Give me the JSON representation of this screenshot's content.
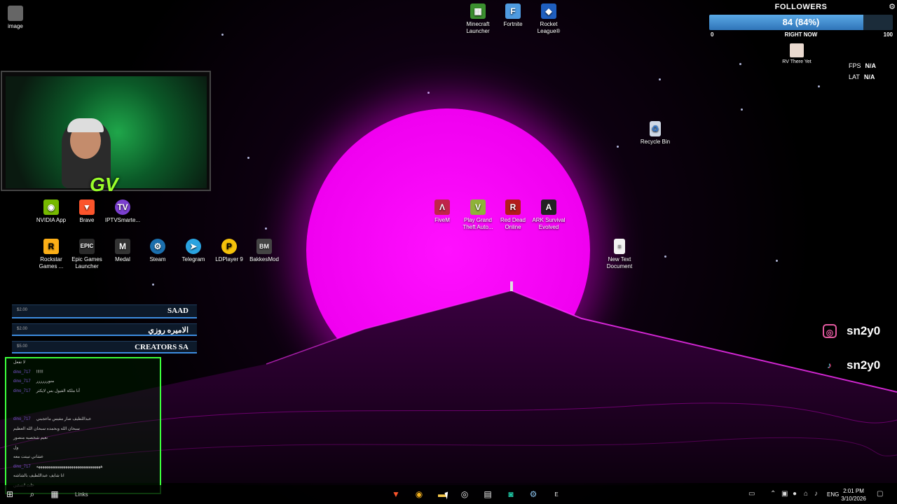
{
  "desktop_icons": {
    "top_left": {
      "label": "image",
      "icon": "image-file-icon"
    },
    "games_top": [
      {
        "label": "Minecraft Launcher",
        "icon": "minecraft-icon",
        "color": "#3b8f2f"
      },
      {
        "label": "Fortnite",
        "icon": "fortnite-icon",
        "color": "#4f9be0"
      },
      {
        "label": "Rocket League®",
        "icon": "rocket-league-icon",
        "color": "#1f5fbf"
      }
    ],
    "row1": [
      {
        "label": "NVIDIA App",
        "icon": "nvidia-icon",
        "color": "#76b900"
      },
      {
        "label": "Brave",
        "icon": "brave-icon",
        "color": "#fb542b"
      },
      {
        "label": "IPTVSmarte...",
        "icon": "iptv-icon",
        "color": "#7b3fd0"
      }
    ],
    "row2": [
      {
        "label": "Rockstar Games ...",
        "icon": "rockstar-icon",
        "color": "#fcaf17"
      },
      {
        "label": "Epic Games Launcher",
        "icon": "epic-games-icon",
        "color": "#2a2a2a"
      },
      {
        "label": "Medal",
        "icon": "medal-icon",
        "color": "#333333"
      },
      {
        "label": "Steam",
        "icon": "steam-icon",
        "color": "#1b6fae"
      },
      {
        "label": "Telegram",
        "icon": "telegram-icon",
        "color": "#2aa3e0"
      },
      {
        "label": "LDPlayer 9",
        "icon": "ldplayer-icon",
        "color": "#f5c20b"
      },
      {
        "label": "BakkesMod",
        "icon": "bakkesmod-icon",
        "color": "#444444"
      }
    ],
    "center": [
      {
        "label": "FiveM",
        "icon": "fivem-icon",
        "color": "#c0244a"
      },
      {
        "label": "Play Grand Theft Auto...",
        "icon": "gta-icon",
        "color": "#8fb339"
      },
      {
        "label": "Red Dead Online",
        "icon": "red-dead-icon",
        "color": "#b31b1b"
      },
      {
        "label": "ARK Survival Evolved",
        "icon": "ark-icon",
        "color": "#222222"
      }
    ],
    "recycle_bin": {
      "label": "Recycle Bin",
      "icon": "recycle-bin-icon"
    },
    "new_text": {
      "label": "New Text Document",
      "icon": "text-document-icon"
    }
  },
  "followers": {
    "title": "FOLLOWERS",
    "value": "84 (84%)",
    "progress": 0.84,
    "min": "0",
    "max": "100",
    "right_now": "RIGHT NOW",
    "game": "RV There Yet"
  },
  "stats": {
    "fps_label": "FPS",
    "fps_value": "N/A",
    "lat_label": "LAT",
    "lat_value": "N/A"
  },
  "donations": [
    {
      "amount": "$2.00",
      "name": "SAAD"
    },
    {
      "amount": "$2.00",
      "name": "الاميره روزي"
    },
    {
      "amount": "$5.00",
      "name": "CREATORS SA"
    }
  ],
  "chat": [
    {
      "user": "",
      "msg": "لا تفعل"
    },
    {
      "user": "dino_717",
      "msg": "!!!!!!"
    },
    {
      "user": "dino_717",
      "msg": "منورررررر"
    },
    {
      "user": "dino_717",
      "msg": "أنا ملكة الفيول بس لايكثر"
    },
    {
      "user": "",
      "msg": ""
    },
    {
      "user": "",
      "msg": ""
    },
    {
      "user": "dino_717",
      "msg": "عبداللطيف صار مفيس ماعجبني"
    },
    {
      "user": "",
      "msg": "سبحان الله وبحمده سبحان الله العظيم"
    },
    {
      "user": "",
      "msg": "نعيم شخصيه منصور"
    },
    {
      "user": "",
      "msg": "ول"
    },
    {
      "user": "",
      "msg": "عشاني تبيتت معه"
    },
    {
      "user": "dino_717",
      "msg": "هههههههههههههههههههههههههههههههههه"
    },
    {
      "user": "",
      "msg": "انا شايف عبداللطيف بالشاشه"
    },
    {
      "user": "",
      "msg": "حلت ابستين"
    }
  ],
  "socials": [
    {
      "handle": "sn2y0",
      "icon": "instagram-icon"
    },
    {
      "handle": "sn2y0",
      "icon": "tiktok-icon"
    }
  ],
  "taskbar": {
    "links_label": "Links",
    "apps": [
      {
        "icon": "brave-icon",
        "glyph": "🦁"
      },
      {
        "icon": "chrome-icon",
        "glyph": "◉"
      },
      {
        "icon": "file-explorer-icon",
        "glyph": "📁"
      },
      {
        "icon": "obs-icon",
        "glyph": "◎"
      },
      {
        "icon": "window-app-icon",
        "glyph": "▤"
      },
      {
        "icon": "discord-icon",
        "glyph": "◙"
      },
      {
        "icon": "steam-icon",
        "glyph": "⚙"
      },
      {
        "icon": "epic-games-icon",
        "glyph": "E"
      }
    ],
    "language": "ENG",
    "time": "2:01 PM",
    "date": "3/10/2026"
  },
  "colors": {
    "sun": "#ff10ff",
    "chat_border": "#3cff3c",
    "donation_accent": "#3d8de0",
    "follower_bar": "#3a8fd8"
  }
}
